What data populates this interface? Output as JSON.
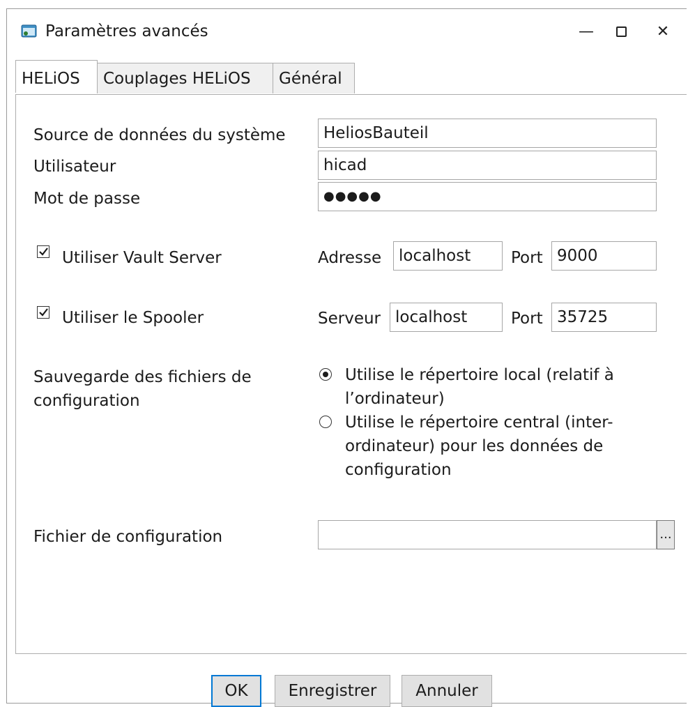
{
  "window": {
    "title": "Paramètres avancés",
    "minimize_glyph": "—",
    "maximize_glyph": "☐",
    "close_glyph": "✕",
    "app_icon": "app-window-icon"
  },
  "tabs": [
    {
      "label": "HELiOS",
      "active": true
    },
    {
      "label": "Couplages HELiOS",
      "active": false
    },
    {
      "label": "Général",
      "active": false
    }
  ],
  "form": {
    "datasource_label": "Source de données du système",
    "datasource_value": "HeliosBauteil",
    "user_label": "Utilisateur",
    "user_value": "hicad",
    "password_label": "Mot de passe",
    "password_value": "●●●●●",
    "vault": {
      "checkbox_label": "Utiliser Vault Server",
      "checked": true,
      "address_label": "Adresse",
      "address_value": "localhost",
      "port_label": "Port",
      "port_value": "9000"
    },
    "spooler": {
      "checkbox_label": "Utiliser le Spooler",
      "checked": true,
      "server_label": "Serveur",
      "server_value": "localhost",
      "port_label": "Port",
      "port_value": "35725"
    },
    "save_config": {
      "label_line1": "Sauvegarde des fichiers de",
      "label_line2": "configuration",
      "option_local_line1": "Utilise le répertoire local (relatif à",
      "option_local_line2": "l’ordinateur)",
      "option_central_line1": "Utilise le répertoire central (inter-",
      "option_central_line2": "ordinateur) pour les données de",
      "option_central_line3": "configuration",
      "selected": "local"
    },
    "config_file_label": "Fichier de configuration",
    "config_file_value": "",
    "browse_label": "..."
  },
  "buttons": {
    "ok": "OK",
    "save": "Enregistrer",
    "cancel": "Annuler"
  },
  "colors": {
    "default_button_border": "#0078d4",
    "button_bg": "#e1e1e1"
  }
}
